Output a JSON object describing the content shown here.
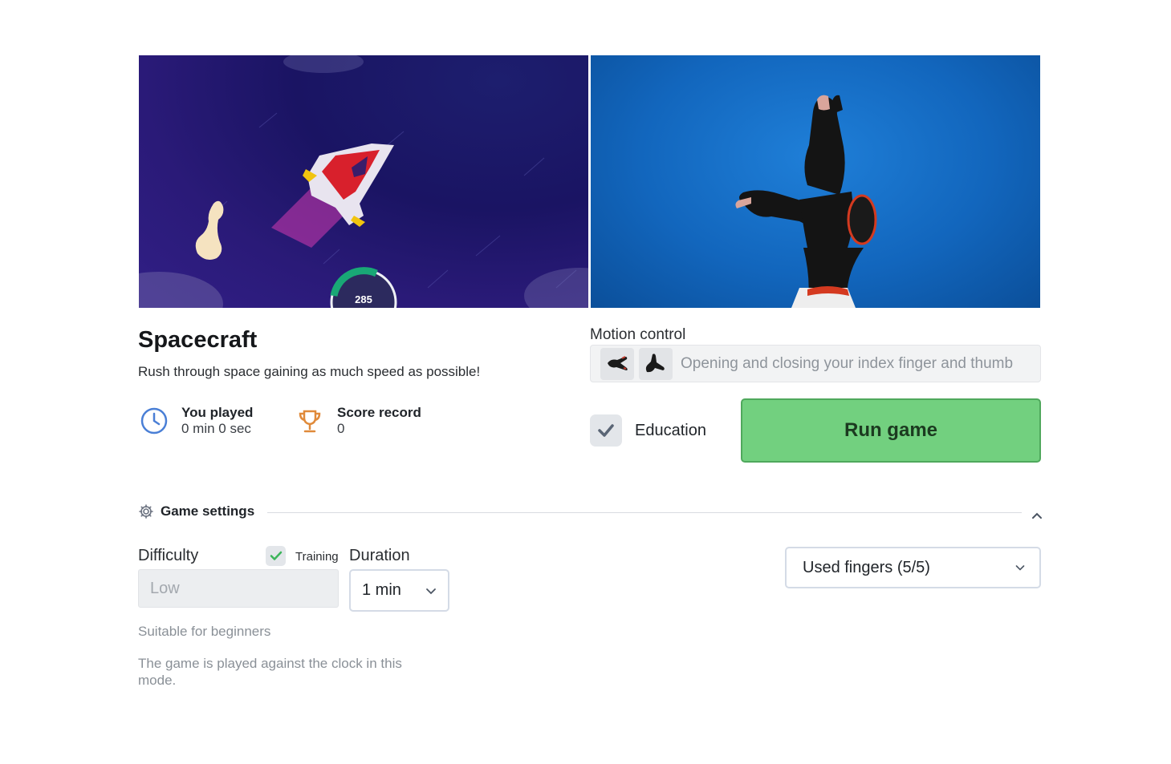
{
  "game": {
    "title": "Spacecraft",
    "description": "Rush through space gaining as much speed as possible!",
    "hud_speed": "285"
  },
  "stats": {
    "played_label": "You played",
    "played_value": "0 min 0 sec",
    "record_label": "Score record",
    "record_value": "0"
  },
  "motion_control": {
    "label": "Motion control",
    "description": "Opening and closing your index finger and thumb"
  },
  "education": {
    "label": "Education",
    "checked": true
  },
  "run_button": "Run game",
  "settings": {
    "title": "Game settings",
    "difficulty_label": "Difficulty",
    "difficulty_value": "Low",
    "training_label": "Training",
    "training_checked": true,
    "duration_label": "Duration",
    "duration_value": "1 min",
    "fingers_value": "Used fingers (5/5)",
    "difficulty_help": "Suitable for beginners",
    "mode_help": "The game is played against the clock in this mode."
  },
  "colors": {
    "run_button": "#72d07f",
    "accent_blue": "#4a7fd6",
    "trophy": "#e08a3a",
    "check_green": "#3cb55a"
  }
}
